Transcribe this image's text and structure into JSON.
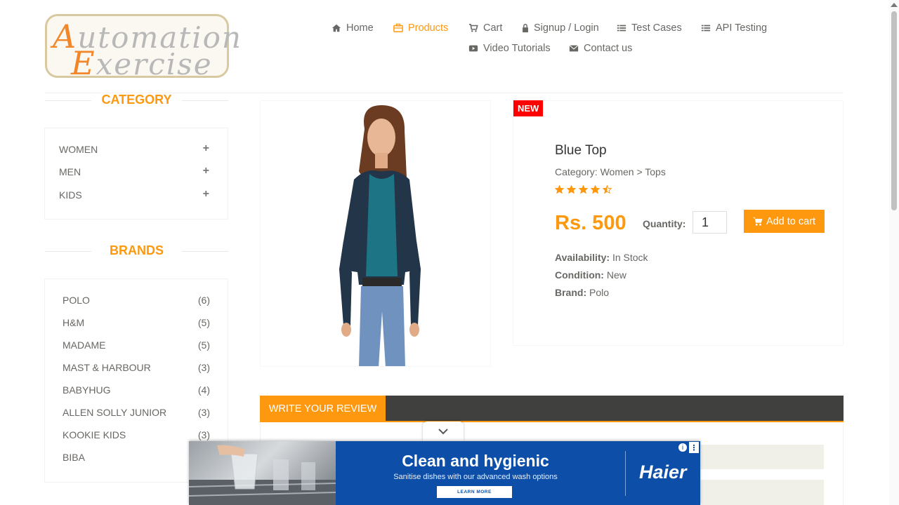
{
  "logo": {
    "line1_big": "A",
    "line1_rest": "utomation",
    "line2_big": "E",
    "line2_rest": "xercise"
  },
  "nav": {
    "items": [
      {
        "label": "Home",
        "icon": "home-icon"
      },
      {
        "label": "Products",
        "icon": "products-icon",
        "active": true
      },
      {
        "label": "Cart",
        "icon": "cart-icon"
      },
      {
        "label": "Signup / Login",
        "icon": "lock-icon"
      },
      {
        "label": "Test Cases",
        "icon": "list-icon"
      },
      {
        "label": "API Testing",
        "icon": "list-icon"
      },
      {
        "label": "Video Tutorials",
        "icon": "youtube-icon"
      },
      {
        "label": "Contact us",
        "icon": "envelope-icon"
      }
    ]
  },
  "sidebar": {
    "category_heading": "CATEGORY",
    "categories": [
      {
        "label": "WOMEN",
        "toggle": "+"
      },
      {
        "label": "MEN",
        "toggle": "+"
      },
      {
        "label": "KIDS",
        "toggle": "+"
      }
    ],
    "brands_heading": "BRANDS",
    "brands": [
      {
        "label": "POLO",
        "count": "(6)"
      },
      {
        "label": "H&M",
        "count": "(5)"
      },
      {
        "label": "MADAME",
        "count": "(5)"
      },
      {
        "label": "MAST & HARBOUR",
        "count": "(3)"
      },
      {
        "label": "BABYHUG",
        "count": "(4)"
      },
      {
        "label": "ALLEN SOLLY JUNIOR",
        "count": "(3)"
      },
      {
        "label": "KOOKIE KIDS",
        "count": "(3)"
      },
      {
        "label": "BIBA",
        "count": ""
      }
    ]
  },
  "product": {
    "badge": "NEW",
    "name": "Blue Top",
    "category": "Category: Women > Tops",
    "rating": 4.5,
    "price": "Rs. 500",
    "quantity_label": "Quantity:",
    "quantity_value": "1",
    "add_to_cart": "Add to cart",
    "availability_label": "Availability:",
    "availability_value": "In Stock",
    "condition_label": "Condition:",
    "condition_value": "New",
    "brand_label": "Brand:",
    "brand_value": "Polo"
  },
  "review": {
    "tab_label": "WRITE YOUR REVIEW"
  },
  "ad": {
    "headline": "Clean and hygienic",
    "subline": "Sanitise dishes with our advanced wash options",
    "cta": "LEARN MORE",
    "brand": "Haier",
    "info_icon": "info-icon",
    "menu_icon": "kebab-icon"
  },
  "colors": {
    "accent": "#fe980f",
    "badge": "#ff0000",
    "review_bar": "#40403e",
    "ad_bg": "#0c4ea8"
  }
}
